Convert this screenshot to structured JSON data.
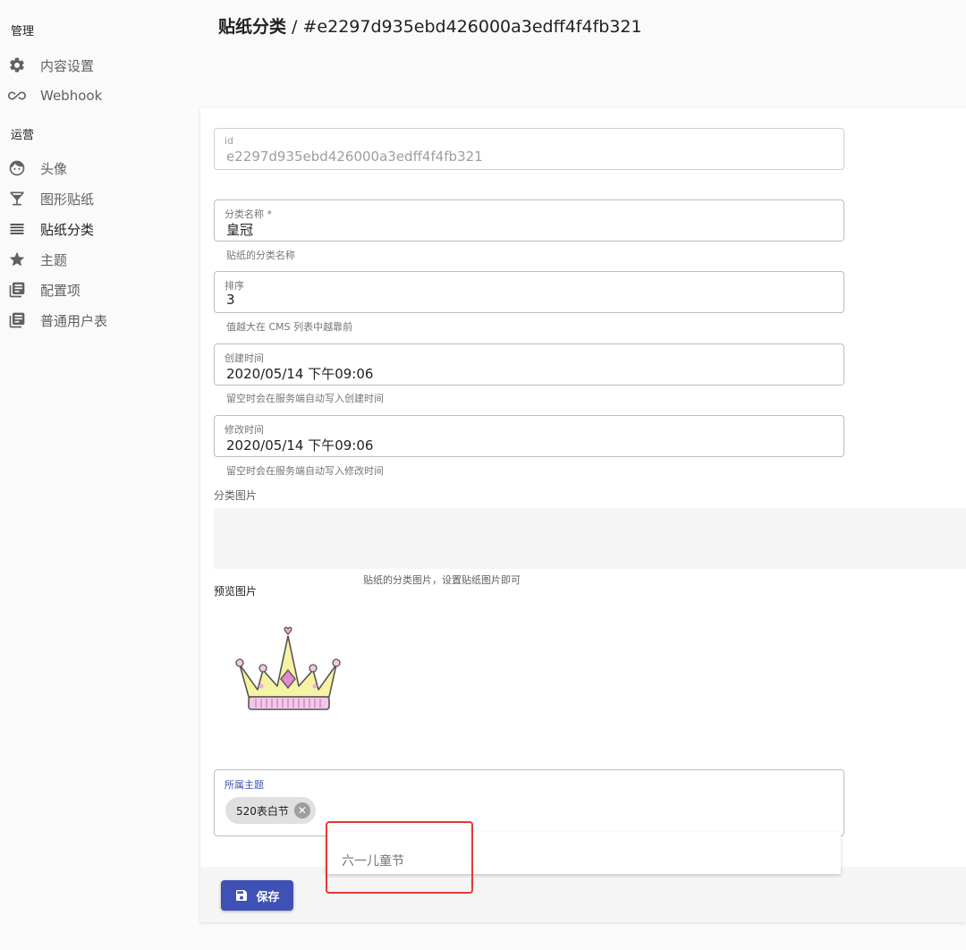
{
  "sidebar": {
    "sections": [
      {
        "title": "管理"
      },
      {
        "title": "运营"
      }
    ],
    "items": [
      {
        "label": "内容设置",
        "icon": "gear-icon"
      },
      {
        "label": "Webhook",
        "icon": "infinity-icon"
      },
      {
        "label": "头像",
        "icon": "face-icon"
      },
      {
        "label": "图形贴纸",
        "icon": "cocktail-icon"
      },
      {
        "label": "贴纸分类",
        "icon": "list-icon"
      },
      {
        "label": "主题",
        "icon": "star-icon"
      },
      {
        "label": "配置项",
        "icon": "library-icon"
      },
      {
        "label": "普通用户表",
        "icon": "library-icon"
      }
    ]
  },
  "header": {
    "resource": "贴纸分类",
    "separator": " / ",
    "record_id": "#e2297d935ebd426000a3edff4f4fb321"
  },
  "form": {
    "id": {
      "label": "id",
      "value": "e2297d935ebd426000a3edff4f4fb321"
    },
    "name": {
      "label": "分类名称 *",
      "value": "皇冠",
      "helper": "贴纸的分类名称"
    },
    "order": {
      "label": "排序",
      "value": "3",
      "helper": "值越大在 CMS 列表中越靠前"
    },
    "created": {
      "label": "创建时间",
      "value": "2020/05/14 下午09:06",
      "helper": "留空时会在服务端自动写入创建时间"
    },
    "updated": {
      "label": "修改时间",
      "value": "2020/05/14 下午09:06",
      "helper": "留空时会在服务端自动写入修改时间"
    },
    "image": {
      "label": "分类图片",
      "helper": "贴纸的分类图片，设置贴纸图片即可"
    },
    "preview": {
      "label": "预览图片"
    },
    "theme": {
      "label": "所属主题",
      "chips": [
        "520表白节"
      ],
      "suggestion": "六一儿童节"
    }
  },
  "toolbar": {
    "save_label": "保存"
  },
  "colors": {
    "primary": "#3f51b5",
    "highlight": "#e53935"
  }
}
